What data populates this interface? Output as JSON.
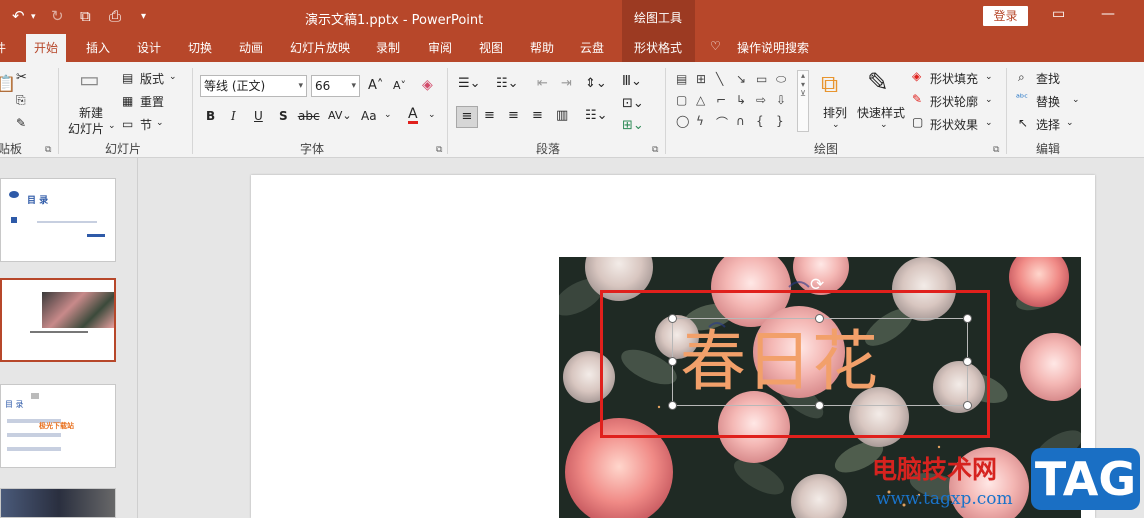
{
  "titlebar": {
    "doc_title": "演示文稿1.pptx  -  PowerPoint",
    "context_group": "绘图工具",
    "login": "登录"
  },
  "tabs": [
    "开始",
    "插入",
    "设计",
    "切换",
    "动画",
    "幻灯片放映",
    "录制",
    "审阅",
    "视图",
    "帮助",
    "云盘",
    "形状格式"
  ],
  "tell_me": "操作说明搜索",
  "ribbon": {
    "clipboard": {
      "label": "贴板"
    },
    "slides": {
      "new_slide": "新建",
      "new_slide2": "幻灯片",
      "layout": "版式",
      "reset": "重置",
      "section": "节",
      "label": "幻灯片"
    },
    "font": {
      "font_name": "等线 (正文)",
      "font_size": "66",
      "label": "字体",
      "bold": "B",
      "italic": "I",
      "underline": "U",
      "shadow": "S",
      "case": "Aa"
    },
    "paragraph": {
      "label": "段落"
    },
    "drawing": {
      "arrange": "排列",
      "quick_styles": "快速样式",
      "fill": "形状填充",
      "outline": "形状轮廓",
      "effects": "形状效果",
      "label": "绘图"
    },
    "editing": {
      "find": "查找",
      "replace": "替换",
      "select": "选择",
      "label": "编辑"
    }
  },
  "thumbnails": {
    "t1_title": "目    录",
    "t3_title": "目 录",
    "t3_badge": "极光下载站"
  },
  "slide": {
    "text": "春日花"
  },
  "watermark": {
    "line1": "电脑技术网",
    "line2": "www.tagxp.com",
    "badge": "TAG"
  },
  "colors": {
    "accent": "#b7472a",
    "selection_frame": "#e0201c",
    "slide_text": "#f2a06a"
  }
}
